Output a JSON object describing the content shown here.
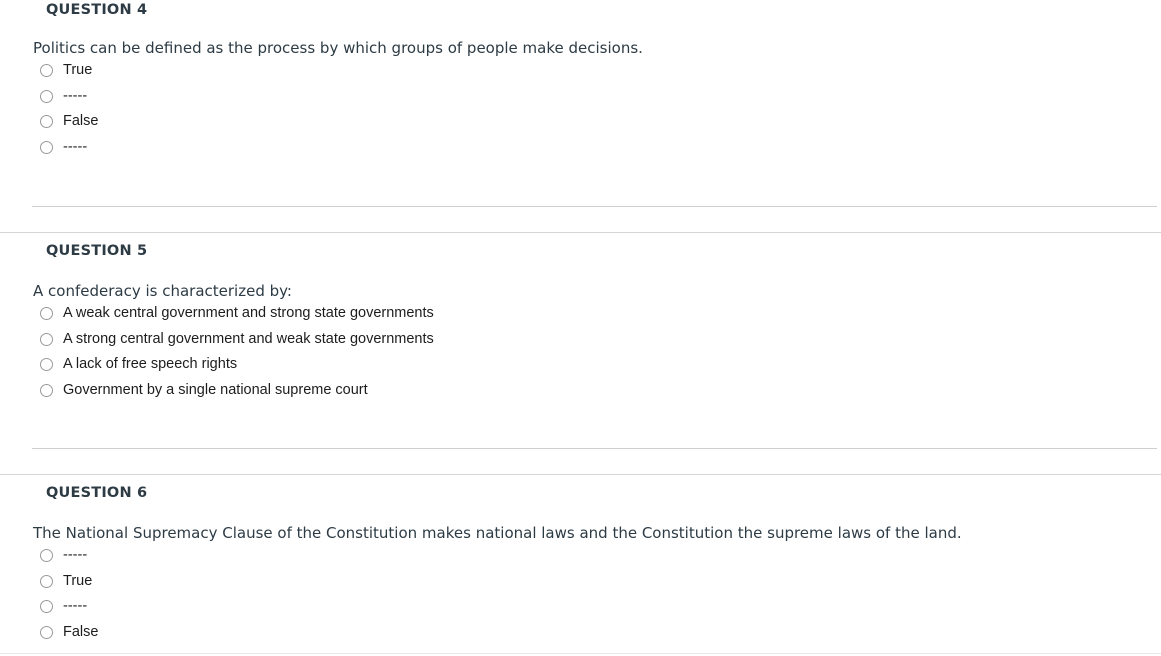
{
  "page": {
    "kind": "quiz-questions",
    "background_color": "#ffffff",
    "heading_color": "#2d3b45",
    "body_text_color": "#2d3b45",
    "option_text_color": "#1d1d1d",
    "divider_color": "#cfcfcf"
  },
  "questions": [
    {
      "id": "q4",
      "title": "QUESTION 4",
      "text": "Politics can be defined as the process by which groups of people make decisions.",
      "options": [
        {
          "label": "True",
          "selected": false
        },
        {
          "label": "-----",
          "selected": false
        },
        {
          "label": "False",
          "selected": false
        },
        {
          "label": "-----",
          "selected": false
        }
      ]
    },
    {
      "id": "q5",
      "title": "QUESTION 5",
      "text": "A confederacy is characterized by:",
      "options": [
        {
          "label": "A weak central government and strong state governments",
          "selected": false
        },
        {
          "label": "A strong central government and weak state governments",
          "selected": false
        },
        {
          "label": "A lack of free speech rights",
          "selected": false
        },
        {
          "label": "Government by a single national supreme court",
          "selected": false
        }
      ]
    },
    {
      "id": "q6",
      "title": "QUESTION 6",
      "text": "The National Supremacy Clause of the Constitution makes national laws and the Constitution the supreme laws of the land.",
      "options": [
        {
          "label": "-----",
          "selected": false
        },
        {
          "label": "True",
          "selected": false
        },
        {
          "label": "-----",
          "selected": false
        },
        {
          "label": "False",
          "selected": false
        }
      ]
    }
  ]
}
